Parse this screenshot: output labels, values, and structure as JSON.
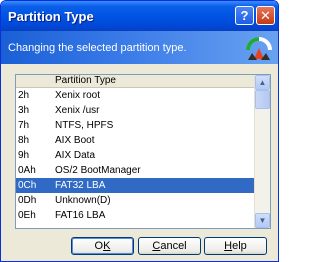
{
  "window": {
    "title": "Partition Type",
    "help_glyph": "?",
    "close_glyph": "✕"
  },
  "banner": {
    "text": "Changing the selected partition type.",
    "icon": "partition-icon"
  },
  "list": {
    "column_header": "Partition Type",
    "rows": [
      {
        "code": "2h",
        "name": "Xenix root"
      },
      {
        "code": "3h",
        "name": "Xenix /usr"
      },
      {
        "code": "7h",
        "name": "NTFS, HPFS"
      },
      {
        "code": "8h",
        "name": "AIX Boot"
      },
      {
        "code": "9h",
        "name": "AIX Data"
      },
      {
        "code": "0Ah",
        "name": "OS/2 BootManager"
      },
      {
        "code": "0Ch",
        "name": "FAT32 LBA"
      },
      {
        "code": "0Dh",
        "name": "Unknown(D)"
      },
      {
        "code": "0Eh",
        "name": "FAT16 LBA"
      }
    ],
    "selected_code": "0Ch"
  },
  "buttons": {
    "ok": {
      "hotkey": "K",
      "prefix": "O",
      "suffix": ""
    },
    "cancel": {
      "hotkey": "C",
      "prefix": "",
      "suffix": "ancel"
    },
    "help": {
      "hotkey": "H",
      "prefix": "",
      "suffix": "elp"
    }
  },
  "colors": {
    "title_bar": "#0054e3",
    "selection": "#316ac5",
    "banner": "#3a7be8"
  }
}
